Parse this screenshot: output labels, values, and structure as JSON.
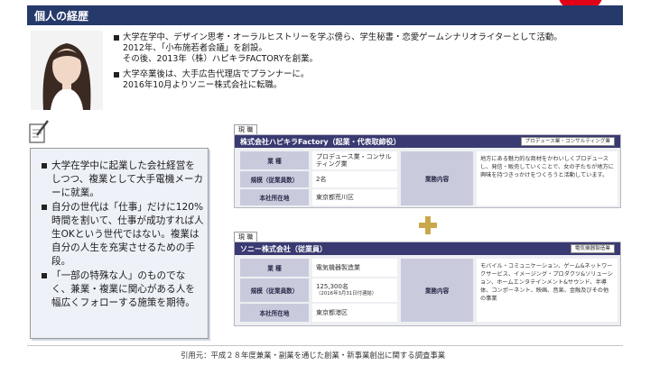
{
  "header": {
    "title": "個人の経歴"
  },
  "bio": [
    {
      "lines": [
        "大学在学中、デザイン思考・オーラルヒストリーを学ぶ傍ら、学生秘書・恋愛ゲームシナリオライターとして活動。",
        "2012年、「小布施若者会議」を創設。",
        "その後、2013年（株）ハピキラFACTORYを創業。"
      ]
    },
    {
      "lines": [
        "大学卒業後は、大手広告代理店でプランナーに。",
        "2016年10月よりソニー株式会社に転職。"
      ]
    }
  ],
  "left_box": {
    "items": [
      "大学在学中に起業した会社経営をしつつ、複業として大手電機メーカーに就業。",
      "自分の世代は「仕事」だけに120%時間を割いて、仕事が成功すれば人生OKという世代ではない。複業は自分の人生を充実させるための手段。",
      "「一部の特殊な人」のものでなく、兼業・複業に関心がある人を幅広くフォローする施策を期待。"
    ]
  },
  "card1": {
    "tag": "現 職",
    "title": "株式会社ハピキラFactory（起業・代表取締役）",
    "badge": "プロデュース業・コンサルティング業",
    "rows": [
      {
        "label": "業 種",
        "value": "プロデュース業・コンサルティング業",
        "note": ""
      },
      {
        "label": "規模（従業員数）",
        "value": "2名",
        "note": ""
      },
      {
        "label": "本社所在地",
        "value": "東京都荒川区",
        "note": ""
      }
    ],
    "biz_label": "業務内容",
    "biz_text": "地方にある魅力的な商材をかわいしくプロデュース し、発信・販売していくことで、女の子たちが地方に興味を持つきっかけをつくろうと活動しています。"
  },
  "card2": {
    "tag": "現 職",
    "title": "ソニー株式会社（従業員）",
    "badge": "電気機器製造業",
    "rows": [
      {
        "label": "業 種",
        "value": "電気機器製造業",
        "note": ""
      },
      {
        "label": "規模（従業員数）",
        "value": "125,300名",
        "note": "（2016年3月31日付連結）"
      },
      {
        "label": "本社所在地",
        "value": "東京都港区",
        "note": ""
      }
    ],
    "biz_label": "業務内容",
    "biz_text": "モバイル・コミュニケーション、ゲーム&ネットワークサービス、イメージング・プロダクツ&ソリューション、ホームエンタテインメント&サウンド、半導体、コンポーネント、映画、音楽、金融及びその他の事業"
  },
  "footer": {
    "text": "引用元：平成２８年度兼業・副業を通じた創業・新事業創出に関する調査事業"
  },
  "colors": {
    "header_bg": "#25396b",
    "card_header_bg": "#3a3a72",
    "accent_red": "#e00018",
    "plus": "#c9a84a"
  },
  "icons": {
    "note": "note-pencil-icon",
    "plus": "plus-icon"
  }
}
